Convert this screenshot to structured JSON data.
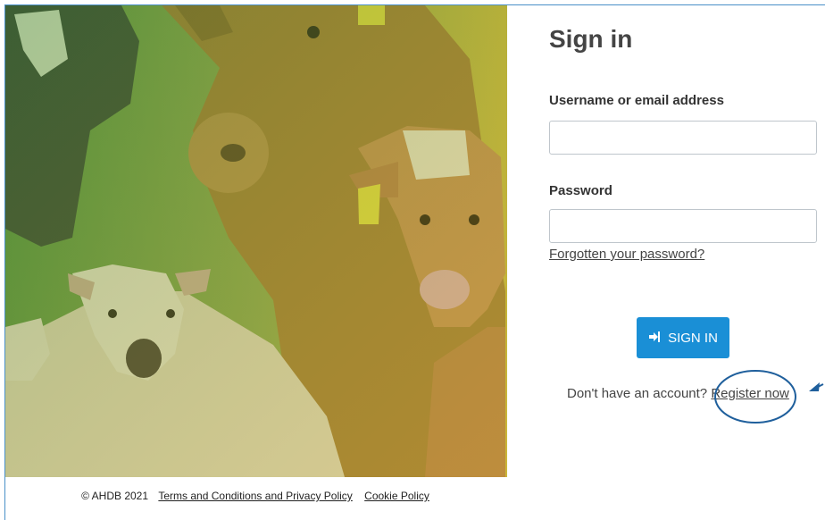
{
  "signin": {
    "title": "Sign in",
    "username_label": "Username or email address",
    "username_value": "",
    "password_label": "Password",
    "password_value": "",
    "forgot_link": "Forgotten your password?",
    "submit_label": "SIGN IN",
    "submit_icon": "sign-in-icon",
    "no_account_text": "Don't have an account?",
    "register_link": "Register now"
  },
  "footer": {
    "copyright": "© AHDB 2021",
    "terms_link": "Terms and Conditions and Privacy Policy",
    "cookie_link": "Cookie Policy"
  },
  "colors": {
    "primary_button": "#1a8fd6",
    "annotation": "#1f5f9c"
  }
}
